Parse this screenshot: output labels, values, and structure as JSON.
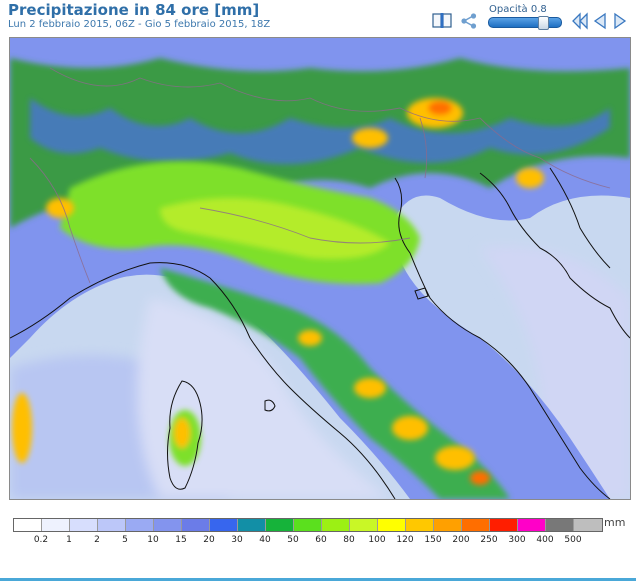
{
  "header": {
    "title": "Precipitazione in 84 ore [mm]",
    "subtitle": "Lun 2 febbraio 2015, 06Z - Gio 5 febbraio 2015, 18Z"
  },
  "toolbar": {
    "opacity_label": "Opacità 0.8",
    "opacity_value": 0.8,
    "icons": [
      "book-icon",
      "share-icon",
      "first-frame-icon",
      "prev-frame-icon",
      "next-frame-icon"
    ]
  },
  "legend": {
    "unit": "mm",
    "ticks": [
      "0.2",
      "1",
      "2",
      "5",
      "10",
      "15",
      "20",
      "30",
      "40",
      "50",
      "60",
      "80",
      "100",
      "120",
      "150",
      "200",
      "250",
      "300",
      "400",
      "500"
    ],
    "colors": [
      "#ffffff",
      "#eef2fe",
      "#d7defd",
      "#bcc7f9",
      "#9aaaf3",
      "#8394ee",
      "#6b7ce8",
      "#3766ee",
      "#128fa6",
      "#16b33a",
      "#5be01e",
      "#9cf014",
      "#c9f726",
      "#ffff00",
      "#ffc800",
      "#ffa000",
      "#ff6e00",
      "#ff1e00",
      "#ff00c8",
      "#787878",
      "#bebebe"
    ]
  },
  "map": {
    "colors": {
      "sea": "#c8d8f0",
      "land_low": "#d6def8",
      "plain": "#7ee02a",
      "plain_core": "#b4ec2a",
      "hills": "#4f86ec",
      "mountain": "#3aa84a",
      "heavy": "#ffbf00",
      "peak": "#ff6e00",
      "coast": "#111111",
      "border": "#8c6a8c"
    }
  }
}
